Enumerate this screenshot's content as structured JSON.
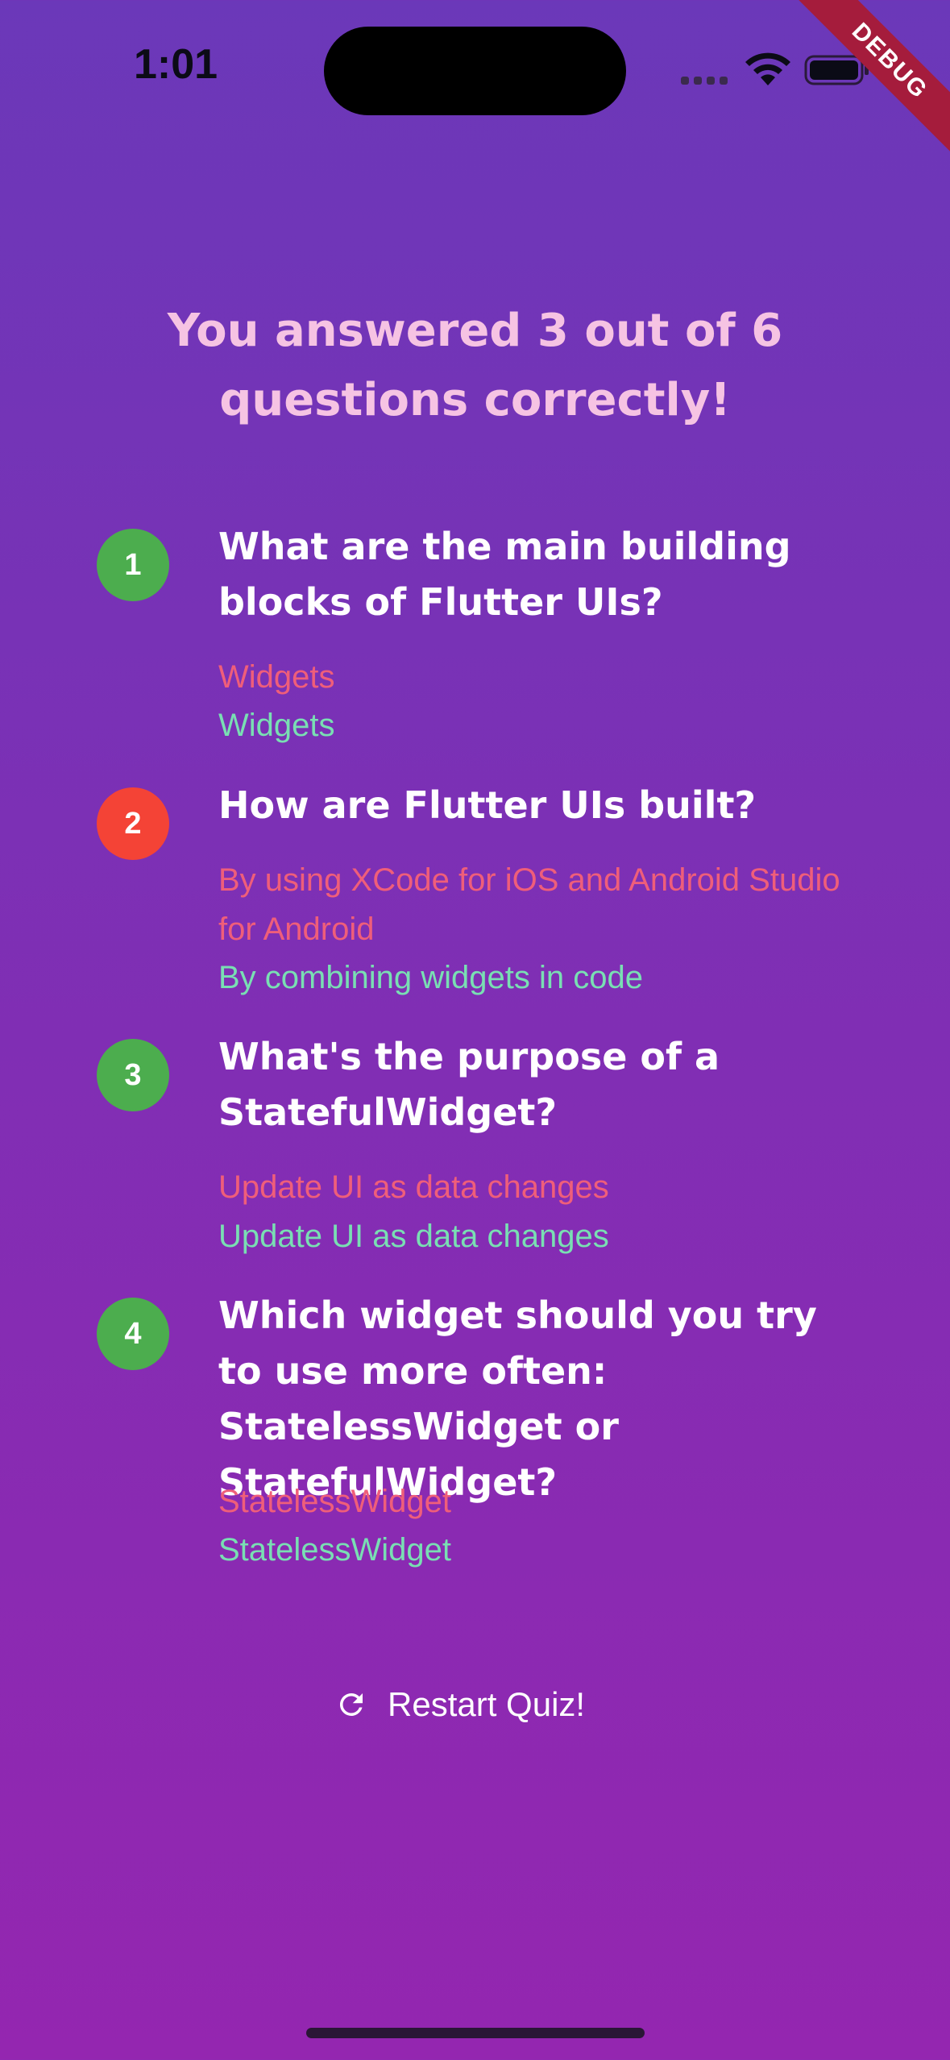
{
  "status_bar": {
    "time": "1:01",
    "icons": [
      "cellular-icon",
      "wifi-icon",
      "battery-icon"
    ]
  },
  "debug_banner": "DEBUG",
  "result": {
    "title": "You answered 3 out of 6 questions correctly!"
  },
  "summary": [
    {
      "number": "1",
      "correct": true,
      "question": "What are the main building blocks of Flutter UIs?",
      "user_answer": "Widgets",
      "correct_answer": "Widgets"
    },
    {
      "number": "2",
      "correct": false,
      "question": "How are Flutter UIs built?",
      "user_answer": "By using XCode for iOS and Android Studio for Android",
      "correct_answer": "By combining widgets in code"
    },
    {
      "number": "3",
      "correct": true,
      "question": "What's the purpose of a StatefulWidget?",
      "user_answer": "Update UI as data changes",
      "correct_answer": "Update UI as data changes"
    },
    {
      "number": "4",
      "correct": true,
      "question": "Which widget should you try to use more often: StatelessWidget or StatefulWidget?",
      "user_answer": "StatelessWidget",
      "correct_answer": "StatelessWidget"
    }
  ],
  "restart_button": {
    "label": "Restart Quiz!",
    "icon": "refresh-icon"
  },
  "colors": {
    "correct": "#4cad4e",
    "wrong": "#f44336",
    "user_answer": "#ef5e7a",
    "correct_answer": "#79dfb3",
    "title": "#f6c3e3"
  }
}
